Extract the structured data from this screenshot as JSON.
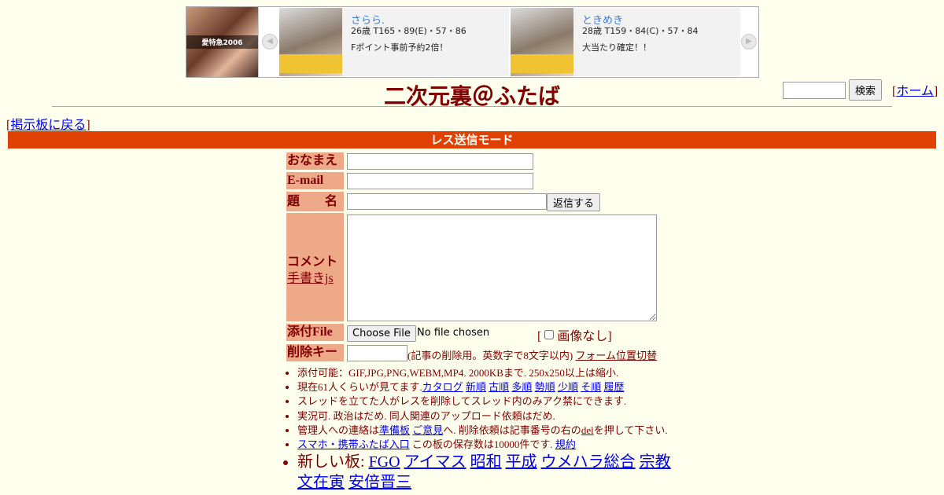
{
  "ad": {
    "banner_text": "愛特急2006",
    "cards": [
      {
        "name": "さらら.",
        "spec": "26歳 T165・89(E)・57・86",
        "desc": "Fポイント事前予約2倍！"
      },
      {
        "name": "ときめき",
        "spec": "28歳 T159・84(C)・57・84",
        "desc": "大当たり確定！！"
      }
    ]
  },
  "header": {
    "title": "二次元裏＠ふたば",
    "search_button": "検索",
    "home_link": "ホーム"
  },
  "back_link": "掲示板に戻る",
  "mode_bar": "レス送信モード",
  "form": {
    "name_label": "おなまえ",
    "email_label": "E-mail",
    "subject_label": "題　　名",
    "submit_button": "返信する",
    "comment_label": "コメント",
    "handwriting_link": "手書きjs",
    "file_label": "添付File",
    "choose_file": "Choose File",
    "no_file": "No file chosen",
    "noimage_label": "画像なし",
    "delkey_label": "削除キー",
    "delkey_note": "(記事の削除用。英数字で8文字以内)",
    "form_position_link": "フォーム位置切替"
  },
  "rules": {
    "r1": "添付可能：GIF,JPG,PNG,WEBM,MP4. 2000KBまで. 250x250以上は縮小.",
    "r2_prefix": "現在61人くらいが見てます.",
    "r2_links": [
      "カタログ",
      "新順",
      "古順",
      "多順",
      "勢順",
      "少順",
      "そ順",
      "履歴"
    ],
    "r3": "スレッドを立てた人がレスを削除してスレッド内のみアク禁にできます.",
    "r4": "実況可. 政治はだめ. 同人関連のアップロード依頼はだめ.",
    "r5_a": "管理人への連絡は",
    "r5_link1": "準備板",
    "r5_link2": "ご意見",
    "r5_b": "へ. 削除依頼は記事番号の右の",
    "r5_del": "del",
    "r5_c": "を押して下さい.",
    "r6_link": "スマホ・携帯ふたば入口",
    "r6_text": " この板の保存数は10000件です.",
    "r6_link2": "規約",
    "new_boards_label": "新しい板:",
    "new_boards": [
      "FGO",
      "アイマス",
      "昭和",
      "平成",
      "ウメハラ総合",
      "宗教",
      "文在寅",
      "安倍晋三"
    ]
  }
}
